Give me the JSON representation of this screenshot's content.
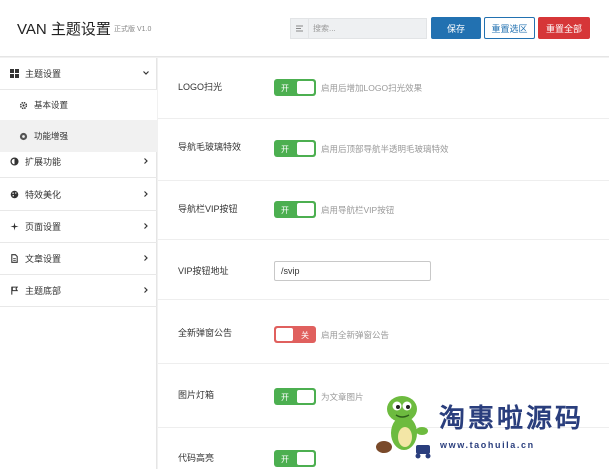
{
  "header": {
    "title": "VAN 主题设置",
    "version": "正式版 V1.0",
    "search": {
      "placeholder": "搜索..."
    },
    "buttons": {
      "save": "保存",
      "reset_selection": "重置选区",
      "reset_all": "重置全部"
    }
  },
  "sidebar": {
    "items": [
      {
        "label": "主题设置",
        "icon": "grid-icon",
        "expanded": true,
        "children": [
          {
            "label": "基本设置",
            "icon": "gear-icon",
            "active": true
          },
          {
            "label": "功能增强",
            "icon": "dot-gear-icon",
            "active": false
          }
        ]
      },
      {
        "label": "扩展功能",
        "icon": "circle-icon"
      },
      {
        "label": "特效美化",
        "icon": "palette-icon"
      },
      {
        "label": "页面设置",
        "icon": "sparkle-icon"
      },
      {
        "label": "文章设置",
        "icon": "document-icon"
      },
      {
        "label": "主题底部",
        "icon": "flag-icon"
      }
    ]
  },
  "settings": [
    {
      "label": "LOGO扫光",
      "type": "toggle",
      "state": "开",
      "on": true,
      "desc": "启用后增加LOGO扫光效果"
    },
    {
      "label": "导航毛玻璃特效",
      "type": "toggle",
      "state": "开",
      "on": true,
      "desc": "启用后顶部导航半透明毛玻璃特效"
    },
    {
      "label": "导航栏VIP按钮",
      "type": "toggle",
      "state": "开",
      "on": true,
      "desc": "启用导航栏VIP按钮"
    },
    {
      "label": "VIP按钮地址",
      "type": "text",
      "value": "/svip"
    },
    {
      "label": "全新弹窗公告",
      "type": "toggle",
      "state": "关",
      "on": false,
      "desc": "启用全新弹窗公告"
    },
    {
      "label": "图片灯箱",
      "type": "toggle",
      "state": "开",
      "on": true,
      "desc": "为文章图片"
    },
    {
      "label": "代码高亮",
      "type": "toggle",
      "state": "开",
      "on": true,
      "desc": ""
    }
  ],
  "watermark": {
    "text": "淘惠啦源码",
    "url": "www.taohuila.cn"
  },
  "colors": {
    "primary": "#2271b1",
    "danger": "#d63638",
    "toggle_on": "#4caf50",
    "toggle_off": "#e0605e",
    "watermark": "#2a3e7d"
  }
}
